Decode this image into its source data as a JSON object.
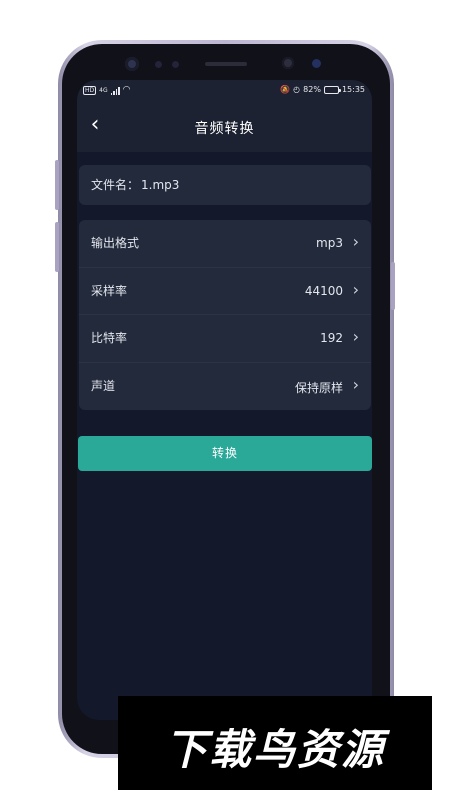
{
  "status_bar": {
    "hd": "HD",
    "network": "4G",
    "battery": "82%",
    "battery_level": 0.82,
    "time": "15:35"
  },
  "header": {
    "back_icon": "chevron-left-icon",
    "title": "音频转换"
  },
  "file": {
    "label": "文件名：",
    "name": "1.mp3"
  },
  "settings": [
    {
      "label": "输出格式",
      "value": "mp3"
    },
    {
      "label": "采样率",
      "value": "44100"
    },
    {
      "label": "比特率",
      "value": "192"
    },
    {
      "label": "声道",
      "value": "保持原样"
    }
  ],
  "convert_button": "转换",
  "watermark": "下载鸟资源",
  "colors": {
    "accent": "#2aa898",
    "background": "#13192a",
    "card": "#222a3b"
  }
}
